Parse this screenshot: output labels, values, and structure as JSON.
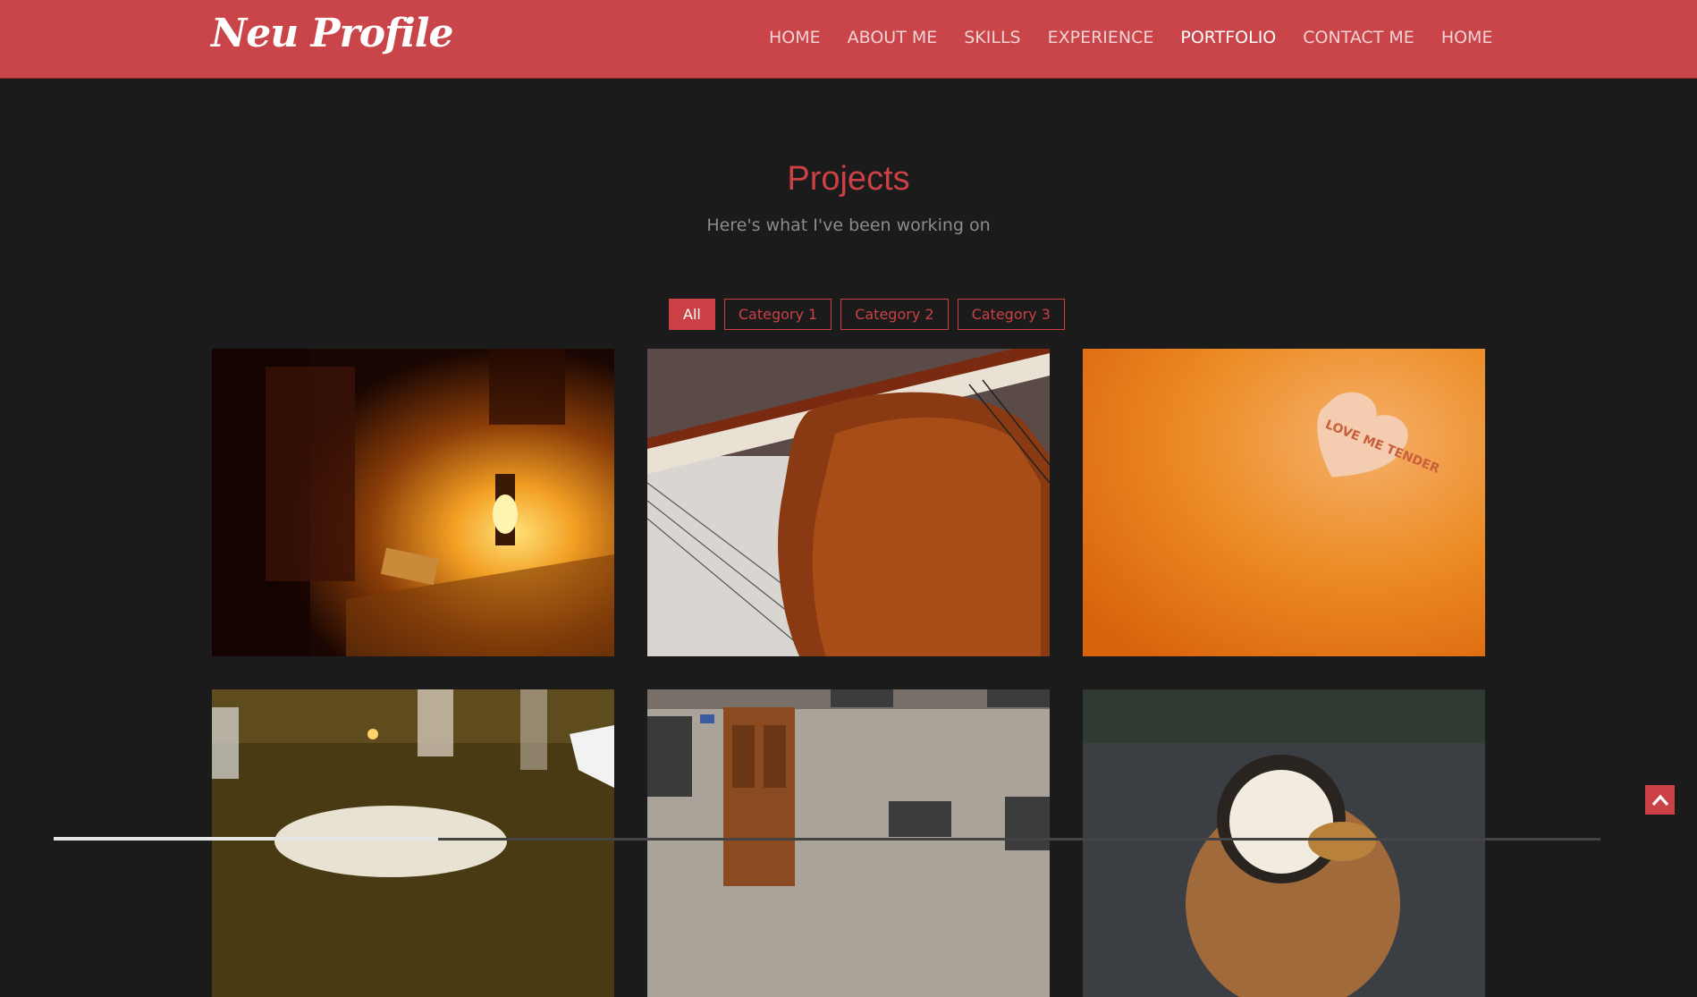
{
  "brand": "Neu Profile",
  "nav": {
    "items": [
      {
        "label": "HOME"
      },
      {
        "label": "ABOUT ME"
      },
      {
        "label": "SKILLS"
      },
      {
        "label": "EXPERIENCE"
      },
      {
        "label": "PORTFOLIO"
      },
      {
        "label": "CONTACT ME"
      },
      {
        "label": "HOME"
      }
    ],
    "active_label": "PORTFOLIO"
  },
  "portfolio": {
    "title": "Projects",
    "subtitle": "Here's what I've been working on",
    "filters": [
      "All",
      "Category 1",
      "Category 2",
      "Category 3"
    ],
    "active_filter": "All",
    "items": [
      {
        "image": "lantern-desk-photo"
      },
      {
        "image": "violin-sheet-music-photo"
      },
      {
        "image": "candy-heart-photo",
        "caption": "LOVE ME TENDER"
      },
      {
        "image": "dinner-table-photo"
      },
      {
        "image": "old-door-facade-photo"
      },
      {
        "image": "coffee-cup-photo"
      }
    ]
  },
  "colors": {
    "accent": "#cb4146",
    "navbar": "#c9454a",
    "background": "#1b1b1b"
  },
  "scroll_top_icon": "chevron-up-icon"
}
